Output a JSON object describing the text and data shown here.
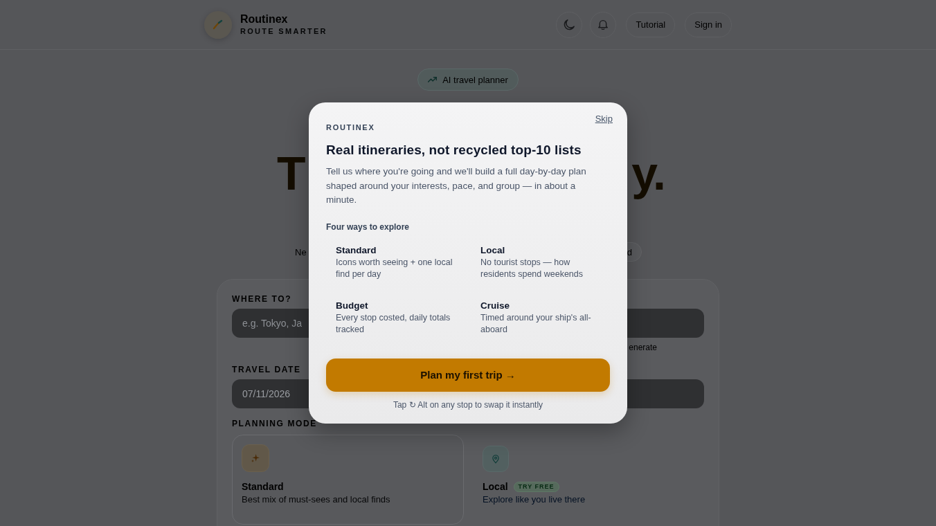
{
  "header": {
    "brand_name": "Routinex",
    "tagline": "ROUTE SMARTER",
    "buttons": [
      "Tutorial",
      "Sign in"
    ]
  },
  "hero": {
    "badge": "AI travel planner",
    "headline_fragments": [
      "T",
      "y."
    ],
    "chips": [
      {
        "label": "Ne",
        "selected": false
      },
      {
        "label": "d",
        "selected": true
      }
    ]
  },
  "form": {
    "destination": {
      "label": "WHERE TO?",
      "placeholder": "e.g. Tokyo, Ja",
      "hint": "enerate"
    },
    "date": {
      "label": "TRAVEL DATE",
      "value": "07/11/2026"
    },
    "planning_mode": {
      "label": "PLANNING MODE",
      "modes": [
        {
          "name": "Standard",
          "description": "Best mix of must-sees and local finds",
          "selected": true
        },
        {
          "name": "Local",
          "badge": "TRY FREE",
          "description": "Explore like you live there",
          "selected": false
        }
      ]
    }
  },
  "dialog": {
    "eyebrow": "ROUTINEX",
    "skip": "Skip",
    "title": "Real itineraries, not recycled top-10 lists",
    "body": "Tell us where you're going and we'll build a full day-by-day plan shaped around your interests, pace, and group — in about a minute.",
    "section_title": "Four ways to explore",
    "ways": [
      {
        "name": "Standard",
        "description": "Icons worth seeing + one local find per day"
      },
      {
        "name": "Local",
        "description": "No tourist stops — how residents spend weekends"
      },
      {
        "name": "Budget",
        "description": "Every stop costed, daily totals tracked"
      },
      {
        "name": "Cruise",
        "description": "Timed around your ship's all-aboard"
      }
    ],
    "cta": "Plan my first trip →",
    "footnote": "Tap ↻ Alt on any stop to swap it instantly"
  }
}
